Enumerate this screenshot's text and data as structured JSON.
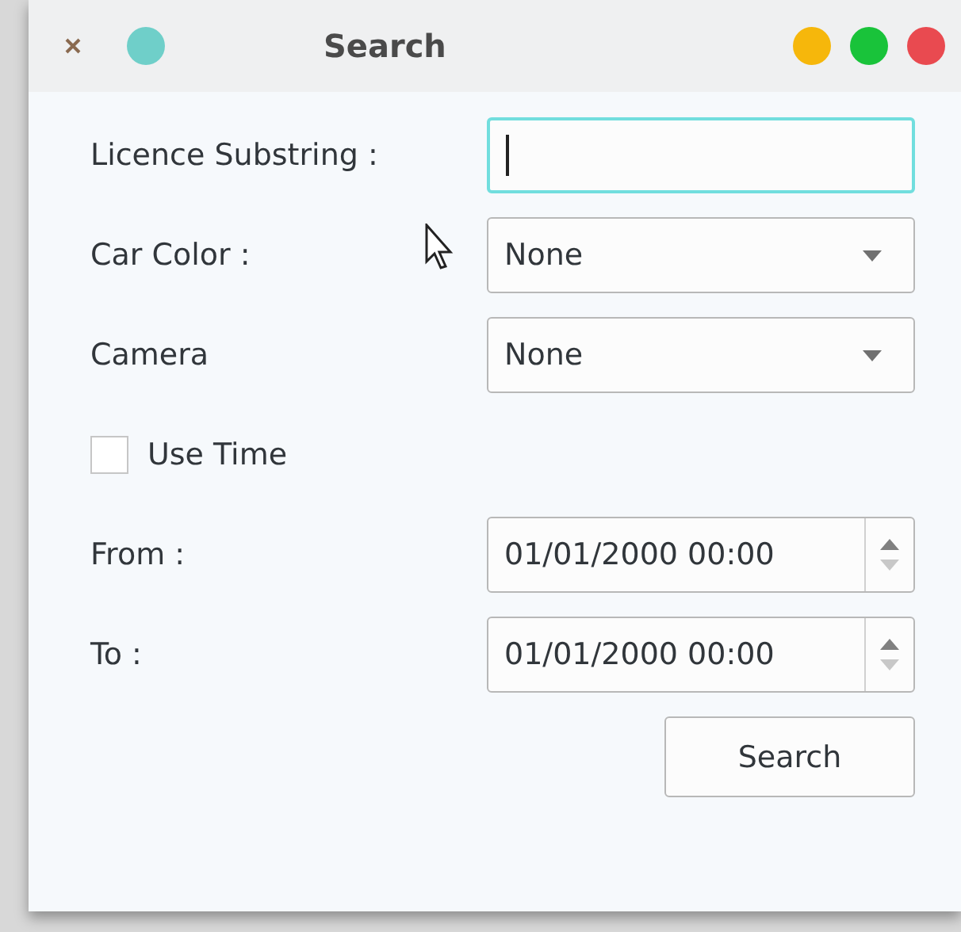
{
  "window": {
    "title": "Search"
  },
  "rows": [
    {
      "kind": "text",
      "label": "Licence Substring :",
      "focused": true
    },
    {
      "kind": "combo",
      "label": "Car Color :",
      "value": "None"
    },
    {
      "kind": "combo",
      "label": "Camera",
      "value": "None"
    },
    {
      "kind": "checkbox",
      "label": "Use Time",
      "checked": false
    },
    {
      "kind": "datetime",
      "label": "From :",
      "value": "01/01/2000 00:00"
    },
    {
      "kind": "datetime",
      "label": "To :",
      "value": "01/01/2000 00:00"
    }
  ],
  "buttons": [
    "Search"
  ]
}
